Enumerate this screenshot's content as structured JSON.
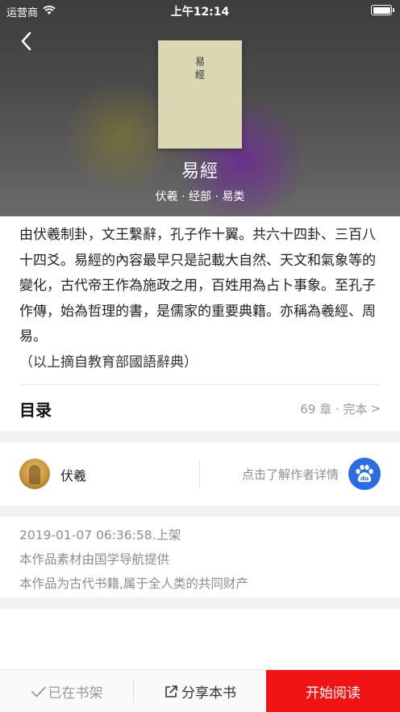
{
  "status_bar": {
    "carrier": "运营商",
    "time": "上午12:14"
  },
  "book": {
    "cover_text": "易經",
    "title": "易經",
    "meta": "伏羲 · 经部 · 易类"
  },
  "description": {
    "text": "由伏羲制卦，文王繫辭，孔子作十翼。共六十四卦、三百八十四爻。易經的內容最早只是記載大自然、天文和氣象等的變化，古代帝王作為施政之用，百姓用為占卜事象。至孔子作傳，始為哲理的書，是儒家的重要典籍。亦稱為羲經、周易。",
    "note": "（以上摘自教育部國語辭典）"
  },
  "toc": {
    "label": "目录",
    "info": "69 章 · 完本",
    "chevron": ">"
  },
  "author": {
    "name": "伏羲",
    "link_text": "点击了解作者详情",
    "badge_text": "du"
  },
  "info": {
    "date": "2019-01-07 06:36:58.上架",
    "source": "本作品素材由国学导航提供",
    "rights": "本作品为古代书籍,属于全人类的共同财产"
  },
  "bottom_bar": {
    "shelf_label": "已在书架",
    "share_label": "分享本书",
    "read_label": "开始阅读"
  },
  "colors": {
    "accent_red": "#f01414",
    "baidu_blue": "#2b6ce0"
  },
  "icons": [
    "wifi-icon",
    "battery-icon",
    "back-icon",
    "baidu-icon",
    "check-icon",
    "share-icon"
  ]
}
